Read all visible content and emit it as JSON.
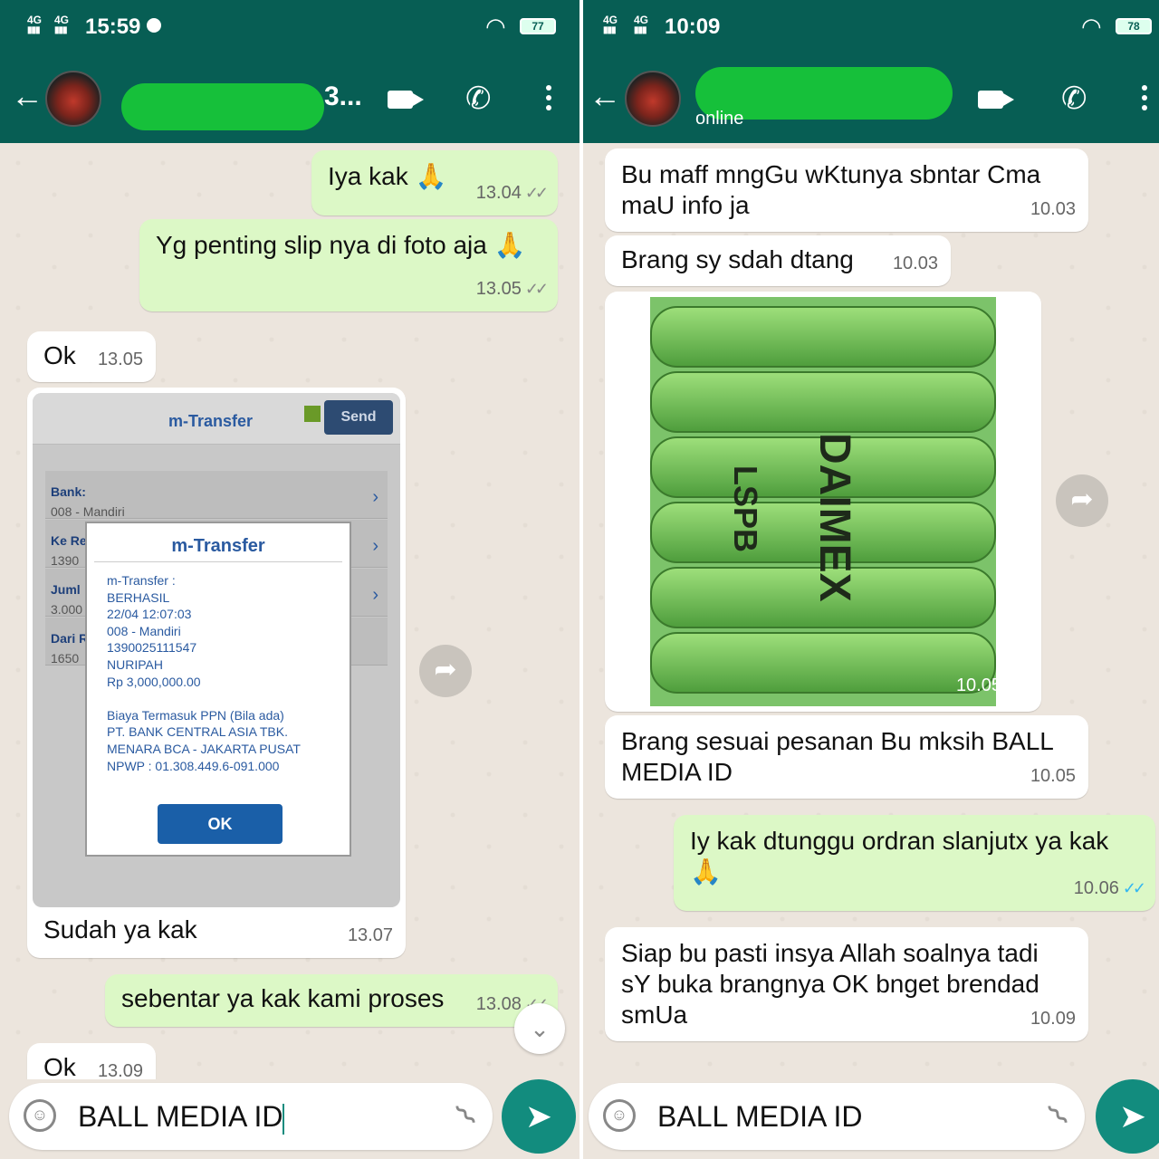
{
  "left": {
    "status": {
      "network1": "4G",
      "network2": "4G",
      "time": "15:59",
      "battery": "77"
    },
    "header": {
      "name_tail": "3..."
    },
    "messages": [
      {
        "dir": "out",
        "text": "Iya kak 🙏",
        "time": "13.04"
      },
      {
        "dir": "out",
        "text": "Yg penting slip nya di foto aja 🙏",
        "time": "13.05"
      },
      {
        "dir": "in",
        "text": "Ok",
        "time": "13.05"
      },
      {
        "dir": "in",
        "caption": "Sudah ya kak",
        "time": "13.07"
      },
      {
        "dir": "out",
        "text": "sebentar ya kak kami proses",
        "time": "13.08"
      },
      {
        "dir": "in",
        "text": "Ok",
        "time": "13.09"
      }
    ],
    "transfer": {
      "title": "m-Transfer",
      "send": "Send",
      "rows": [
        {
          "label": "Bank:",
          "value": "008 - Mandiri"
        },
        {
          "label": "Ke Re",
          "value": "1390"
        },
        {
          "label": "Juml",
          "value": "3.000"
        },
        {
          "label": "Dari R",
          "value": "1650"
        }
      ],
      "dialog": {
        "title": "m-Transfer",
        "lines": [
          "m-Transfer :",
          "BERHASIL",
          "22/04 12:07:03",
          "008 - Mandiri",
          "1390025111547",
          "NURIPAH",
          "Rp 3,000,000.00",
          "",
          "Biaya Termasuk PPN (Bila ada)",
          "PT. BANK CENTRAL ASIA TBK.",
          "MENARA BCA - JAKARTA PUSAT",
          "NPWP : 01.308.449.6-091.000"
        ],
        "ok": "OK"
      }
    },
    "composer": {
      "value": "BALL MEDIA ID"
    }
  },
  "right": {
    "status": {
      "network1": "4G",
      "network2": "4G",
      "time": "10:09",
      "battery": "78"
    },
    "header": {
      "presence": "online"
    },
    "messages": [
      {
        "dir": "in",
        "text": "Bu maff mngGu wKtunya sbntar Cma maU info ja",
        "time": "10.03"
      },
      {
        "dir": "in",
        "text": "Brang sy sdah dtang",
        "time": "10.03"
      },
      {
        "dir": "in",
        "media": "photo",
        "time": "10.05"
      },
      {
        "dir": "in",
        "text": "Brang sesuai pesanan Bu mksih BALL MEDIA ID",
        "time": "10.05"
      },
      {
        "dir": "out",
        "text": "Iy kak dtunggu ordran slanjutx ya kak 🙏",
        "time": "10.06"
      },
      {
        "dir": "in",
        "text": "Siap bu pasti insya Allah soalnya tadi sY buka brangnya OK bnget brendad smUa",
        "time": "10.09"
      }
    ],
    "photo_text": {
      "brand": "DAIMEX",
      "code": "LSPB"
    },
    "composer": {
      "value": "BALL MEDIA ID"
    }
  }
}
